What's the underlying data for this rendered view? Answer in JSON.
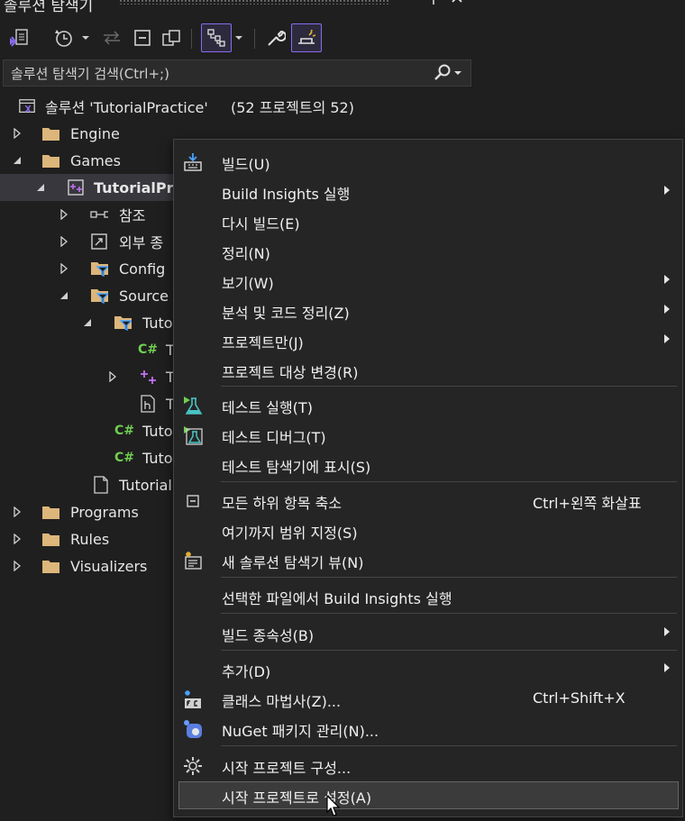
{
  "window": {
    "title": "솔루션 탐색기"
  },
  "colors": {
    "accent": "#8a6cf0",
    "folder": "#dcb67a",
    "csharp": "#6fcf50",
    "panel_bg": "#1f1f1f",
    "menu_bg": "#252526"
  },
  "toolbar": {
    "buttons": [
      {
        "icon": "vs-solution-icon"
      },
      {
        "icon": "history-clock-icon"
      },
      {
        "icon": "sync-arrows-icon"
      },
      {
        "icon": "collapse-all-icon"
      },
      {
        "icon": "show-all-files-icon"
      },
      {
        "icon": "tree-view-icon",
        "active": true
      },
      {
        "icon": "wrench-icon"
      },
      {
        "icon": "preview-pin-icon",
        "active": true
      }
    ]
  },
  "search": {
    "placeholder": "솔루션 탐색기 검색(Ctrl+;)"
  },
  "tree": {
    "solution": {
      "name": "솔루션 'TutorialPractice'",
      "count": "(52 프로젝트의 52)"
    },
    "items": [
      {
        "label": "Engine"
      },
      {
        "label": "Games"
      },
      {
        "label": "TutorialPra"
      },
      {
        "label": "참조"
      },
      {
        "label": "외부 종"
      },
      {
        "label": "Config"
      },
      {
        "label": "Source"
      },
      {
        "label": "Tuto"
      },
      {
        "label": "T"
      },
      {
        "label": "T"
      },
      {
        "label": "T"
      },
      {
        "label": "Tuto"
      },
      {
        "label": "Tuto"
      },
      {
        "label": "Tutorial"
      },
      {
        "label": "Programs"
      },
      {
        "label": "Rules"
      },
      {
        "label": "Visualizers"
      }
    ],
    "csharp_glyph": "C#"
  },
  "context_menu": {
    "items": [
      {
        "label": "빌드(U)",
        "icon": "build-icon"
      },
      {
        "label": "Build Insights 실행",
        "submenu": true
      },
      {
        "label": "다시 빌드(E)"
      },
      {
        "label": "정리(N)"
      },
      {
        "label": "보기(W)",
        "submenu": true
      },
      {
        "label": "분석 및 코드 정리(Z)",
        "submenu": true
      },
      {
        "label": "프로젝트만(J)",
        "submenu": true
      },
      {
        "label": "프로젝트 대상 변경(R)"
      },
      {
        "label": "테스트 실행(T)",
        "icon": "run-tests-icon"
      },
      {
        "label": "테스트 디버그(T)",
        "icon": "debug-tests-icon"
      },
      {
        "label": "테스트 탐색기에 표시(S)"
      },
      {
        "label": "모든 하위 항목 축소",
        "shortcut": "Ctrl+왼쪽 화살표",
        "icon": "collapse-icon"
      },
      {
        "label": "여기까지 범위 지정(S)"
      },
      {
        "label": "새 솔루션 탐색기 뷰(N)",
        "icon": "new-view-icon"
      },
      {
        "label": "선택한 파일에서 Build Insights 실행"
      },
      {
        "label": "빌드 종속성(B)",
        "submenu": true
      },
      {
        "label": "추가(D)",
        "submenu": true
      },
      {
        "label": "클래스 마법사(Z)...",
        "shortcut": "Ctrl+Shift+X",
        "icon": "class-wizard-icon"
      },
      {
        "label": "NuGet 패키지 관리(N)...",
        "icon": "nuget-icon"
      },
      {
        "label": "시작 프로젝트 구성...",
        "icon": "gear-icon"
      },
      {
        "label": "시작 프로젝트로 설정(A)",
        "highlighted": true
      }
    ]
  }
}
